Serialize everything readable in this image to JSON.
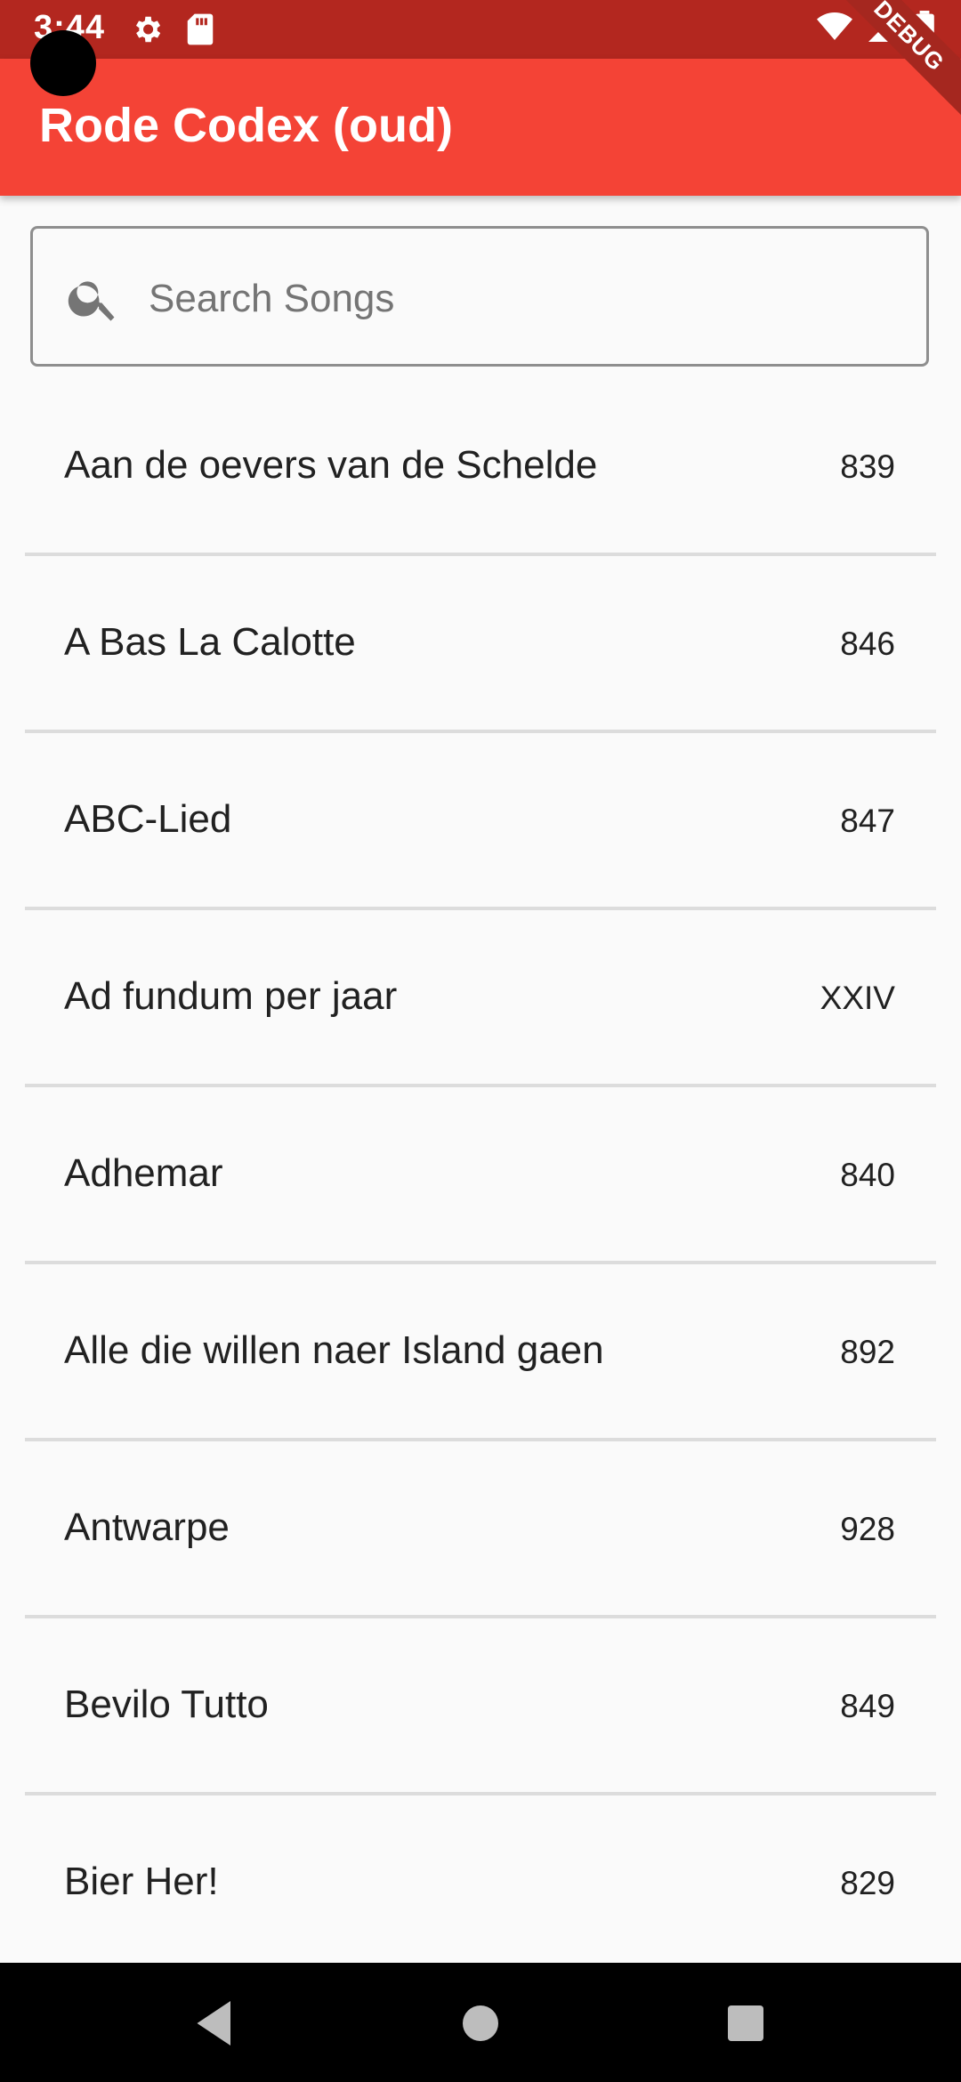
{
  "status_bar": {
    "time": "3:44"
  },
  "app_bar": {
    "title": "Rode Codex (oud)",
    "debug_label": "DEBUG"
  },
  "search": {
    "placeholder": "Search Songs",
    "value": ""
  },
  "songs": [
    {
      "title": "Aan de oevers van de Schelde",
      "number": "839"
    },
    {
      "title": "A Bas La Calotte",
      "number": "846"
    },
    {
      "title": "ABC-Lied",
      "number": "847"
    },
    {
      "title": "Ad fundum per jaar",
      "number": "XXIV"
    },
    {
      "title": "Adhemar",
      "number": "840"
    },
    {
      "title": "Alle die willen naer Island gaen",
      "number": "892"
    },
    {
      "title": "Antwarpe",
      "number": "928"
    },
    {
      "title": "Bevilo Tutto",
      "number": "849"
    },
    {
      "title": "Bier Her!",
      "number": "829"
    }
  ],
  "colors": {
    "app_bar": "#f44336",
    "status_bar": "#b3271f",
    "background": "#fafafa",
    "divider": "#dcdcdc"
  }
}
